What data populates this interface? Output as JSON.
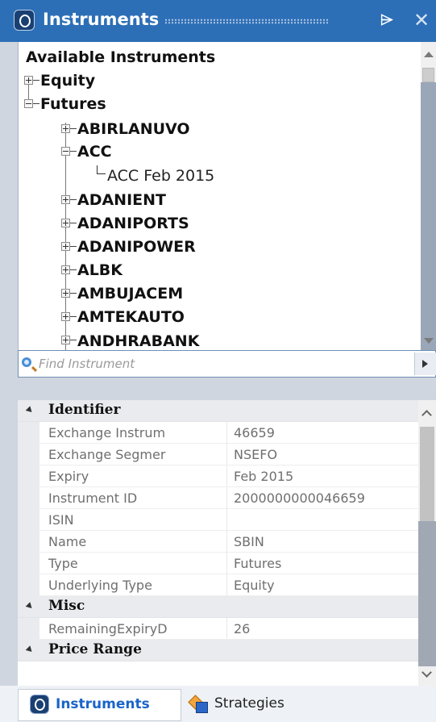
{
  "window": {
    "title": "Instruments",
    "pin_glyph": "⌲",
    "close_glyph": "✕"
  },
  "tree": {
    "root_label": "Available Instruments",
    "nodes": [
      {
        "label": "Equity",
        "state": "collapsed"
      },
      {
        "label": "Futures",
        "state": "expanded"
      },
      {
        "label": "ABIRLANUVO",
        "state": "collapsed"
      },
      {
        "label": "ACC",
        "state": "expanded"
      },
      {
        "label": "ACC Feb 2015",
        "state": "leaf"
      },
      {
        "label": "ADANIENT",
        "state": "collapsed"
      },
      {
        "label": "ADANIPORTS",
        "state": "collapsed"
      },
      {
        "label": "ADANIPOWER",
        "state": "collapsed"
      },
      {
        "label": "ALBK",
        "state": "collapsed"
      },
      {
        "label": "AMBUJACEM",
        "state": "collapsed"
      },
      {
        "label": "AMTEKAUTO",
        "state": "collapsed"
      },
      {
        "label": "ANDHRABANK",
        "state": "collapsed"
      }
    ]
  },
  "search": {
    "placeholder": "Find Instrument"
  },
  "properties": {
    "categories": [
      {
        "name": "Identifier",
        "rows": [
          {
            "name": "Exchange Instrum",
            "value": "46659"
          },
          {
            "name": "Exchange Segmer",
            "value": "NSEFO"
          },
          {
            "name": "Expiry",
            "value": "Feb 2015"
          },
          {
            "name": "Instrument ID",
            "value": "2000000000046659"
          },
          {
            "name": "ISIN",
            "value": ""
          },
          {
            "name": "Name",
            "value": "SBIN"
          },
          {
            "name": "Type",
            "value": "Futures"
          },
          {
            "name": "Underlying Type",
            "value": "Equity"
          }
        ]
      },
      {
        "name": "Misc",
        "rows": [
          {
            "name": "RemainingExpiryD",
            "value": "26"
          }
        ]
      },
      {
        "name": "Price Range",
        "rows": []
      }
    ]
  },
  "tabs": [
    {
      "label": "Instruments",
      "active": true
    },
    {
      "label": "Strategies",
      "active": false
    }
  ],
  "colors": {
    "title_bar": "#2d6fb6",
    "active_tab_text": "#1b64c8"
  }
}
